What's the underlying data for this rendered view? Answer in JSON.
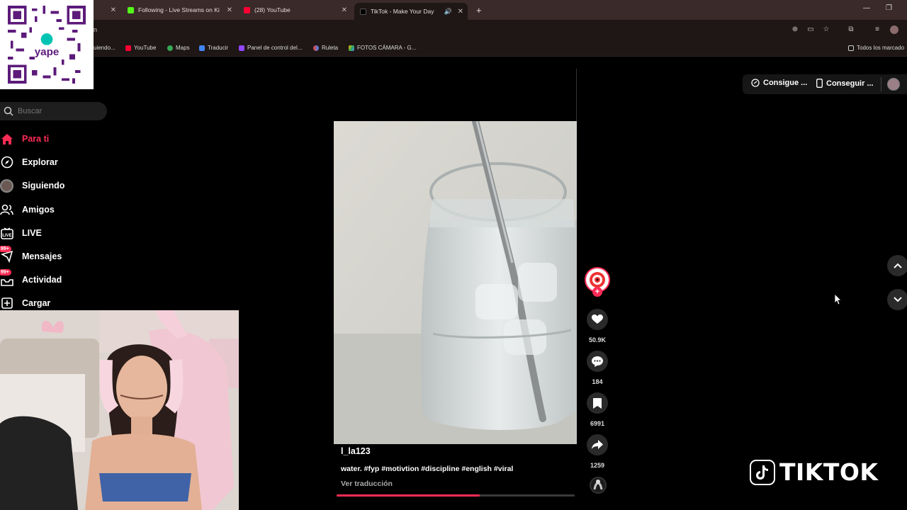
{
  "browser": {
    "tabs": [
      {
        "label": "Following - Live Streams on Ki"
      },
      {
        "label": "(28) YouTube"
      },
      {
        "label": "TikTok - Make Your Day"
      }
    ],
    "address_fragment": "n",
    "bookmarks": [
      {
        "label": "uiendo..."
      },
      {
        "label": "YouTube"
      },
      {
        "label": "Maps"
      },
      {
        "label": "Traducir"
      },
      {
        "label": "Panel de control del..."
      },
      {
        "label": "Ruleta"
      },
      {
        "label": "FOTOS CÁMARA - G..."
      },
      {
        "label": "Todos los marcado"
      }
    ]
  },
  "qr": {
    "brand": "yape"
  },
  "sidebar": {
    "search_placeholder": "Buscar",
    "items": [
      {
        "label": "Para ti",
        "icon": "home-icon"
      },
      {
        "label": "Explorar",
        "icon": "compass-icon"
      },
      {
        "label": "Siguiendo",
        "icon": "following-avatar-icon"
      },
      {
        "label": "Amigos",
        "icon": "friends-icon"
      },
      {
        "label": "LIVE",
        "icon": "live-icon"
      },
      {
        "label": "Mensajes",
        "icon": "messages-icon",
        "badge": "99+"
      },
      {
        "label": "Actividad",
        "icon": "inbox-icon",
        "badge": "99+"
      },
      {
        "label": "Cargar",
        "icon": "upload-icon"
      }
    ]
  },
  "header": {
    "get_coins": "Consigue ...",
    "get_app": "Conseguir ..."
  },
  "video": {
    "author": "l_la123",
    "caption": "water. #fyp #motivtion #discipline #english #viral",
    "translate": "Ver traducción",
    "progress": 0.6
  },
  "actions": {
    "likes": "50.9K",
    "comments": "184",
    "saves": "6991",
    "shares": "1259"
  },
  "watermark": {
    "text": "TIKTOK"
  },
  "colors": {
    "accent": "#fe2c55",
    "chrome": "#3a2a2a"
  }
}
